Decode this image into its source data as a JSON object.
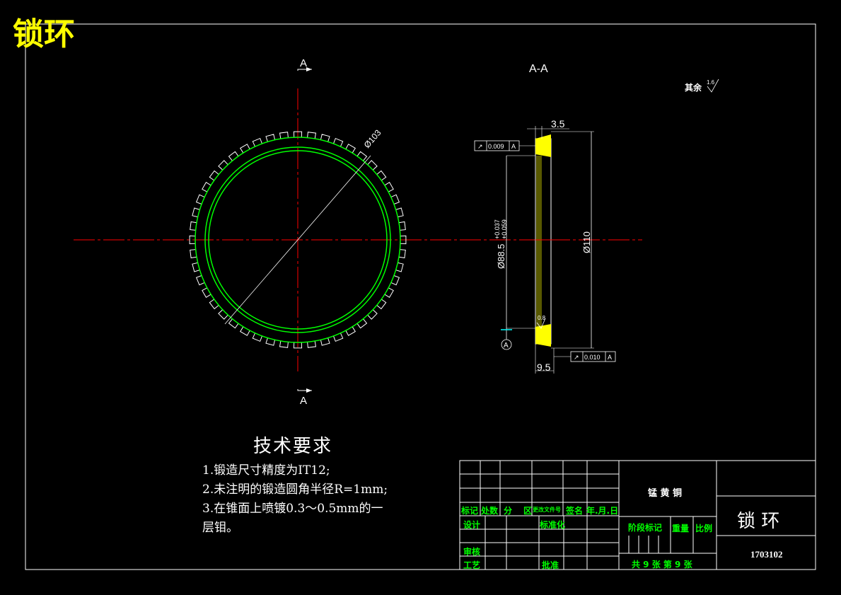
{
  "corner_title": "锁环",
  "section_label": "A-A",
  "section_marks": [
    "A",
    "A"
  ],
  "roughness": {
    "text": "其余",
    "value": "1.6"
  },
  "dimensions": {
    "outer_dia": "Ø103",
    "width_top": "3.5",
    "width_bottom": "9.5",
    "dia_110": "Ø110",
    "dia_88": "Ø88.5",
    "tol_upper": "+0.037",
    "tol_lower": "+0.059",
    "small_roughness": "0.8"
  },
  "tolerance_frames": [
    {
      "symbol": "↗",
      "value": "0.009",
      "datum": "A"
    },
    {
      "symbol": "↗",
      "value": "0.010",
      "datum": "A"
    }
  ],
  "datum": "A",
  "tech_requirements": {
    "title": "技术要求",
    "items": [
      "1.锻造尺寸精度为IT12;",
      "2.未注明的锻造圆角半径R=1mm;",
      "3.在锥面上喷镀0.3～0.5mm的一",
      "层钼。"
    ]
  },
  "title_block": {
    "material": "锰 黄 铜",
    "part_name": "锁  环",
    "drawing_no": "1703102",
    "header_row": [
      "标记",
      "处数",
      "分",
      "区",
      "更改文件号",
      "签名",
      "年.月.日"
    ],
    "design": "设计",
    "standardization": "标准化",
    "review": "审核",
    "process": "工艺",
    "approve": "批准",
    "stage_mark": "阶段标记",
    "weight": "重量",
    "scale": "比例",
    "sheets": "共 9 张   第 9 张"
  },
  "colors": {
    "background": "#000000",
    "outline": "#ffffff",
    "gear": "#ffffff",
    "circles": "#00ff00",
    "centerline": "#ff0000",
    "section_fill": "#ffff00",
    "block_text": "#00ff00"
  }
}
